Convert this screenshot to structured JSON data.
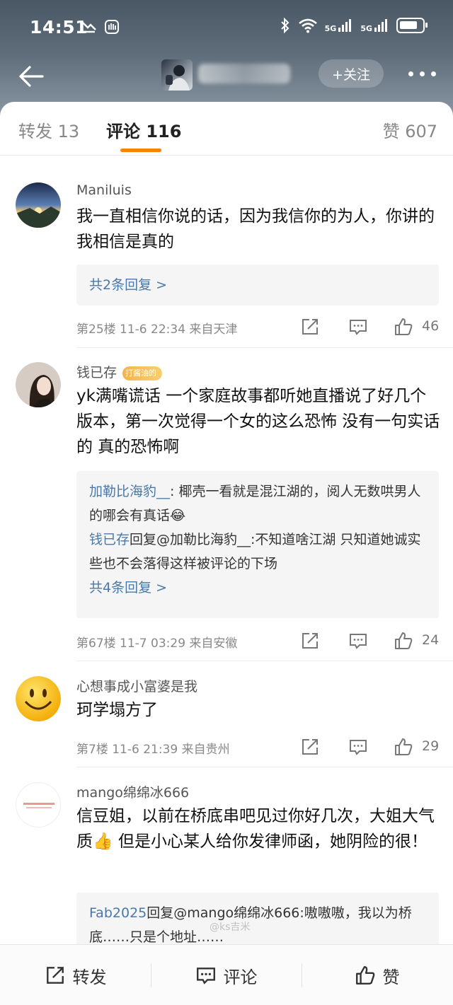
{
  "status_bar": {
    "time": "14:51",
    "net1": "5G",
    "net2": "5G"
  },
  "nav": {
    "follow_label": "+关注"
  },
  "tabs": [
    {
      "label": "转发 13"
    },
    {
      "label": "评论 116"
    },
    {
      "label": "赞 607"
    }
  ],
  "comments": [
    {
      "username": "Maniluis",
      "text": "我一直相信你说的话，因为我信你的为人，你讲的我相信是真的",
      "replies": [],
      "more_replies": "共2条回复 >",
      "meta": "第25楼  11-6 22:34  来自天津",
      "likes": "46"
    },
    {
      "username": "钱已存",
      "badge": "打酱油的",
      "text": "yk满嘴谎话 一个家庭故事都听她直播说了好几个版本，第一次觉得一个女的这么恐怖 没有一句实话的 真的恐怖啊",
      "replies": [
        {
          "name": "加勒比海豹__",
          "text": ": 椰壳一看就是混江湖的，阅人无数哄男人的哪会有真话😂"
        },
        {
          "name": "钱已存",
          "text": "回复@加勒比海豹__:不知道啥江湖 只知道她诚实些也不会落得这样被评论的下场"
        }
      ],
      "more_replies": "共4条回复 >",
      "meta": "第67楼  11-7 03:29  来自安徽",
      "likes": "24"
    },
    {
      "username": "心想事成小富婆是我",
      "text": "珂学塌方了",
      "replies": [],
      "meta": "第7楼  11-6 21:39  来自贵州",
      "likes": "29"
    },
    {
      "username": "mango绵绵冰666",
      "text": "信豆姐，以前在桥底串吧见过你好几次，大姐大气质👍 但是小心某人给你发律师函，她阴险的很！",
      "replies": [
        {
          "name": "Fab2025",
          "text": "回复@mango绵绵冰666:嗷嗷嗷，我以为桥底……只是个地址……"
        }
      ]
    }
  ],
  "bottom_bar": {
    "repost": "转发",
    "comment": "评论",
    "like": "赞"
  },
  "watermark": "@ks吉米",
  "colors": {
    "accent": "#ff8200",
    "link": "#4a78a8"
  }
}
